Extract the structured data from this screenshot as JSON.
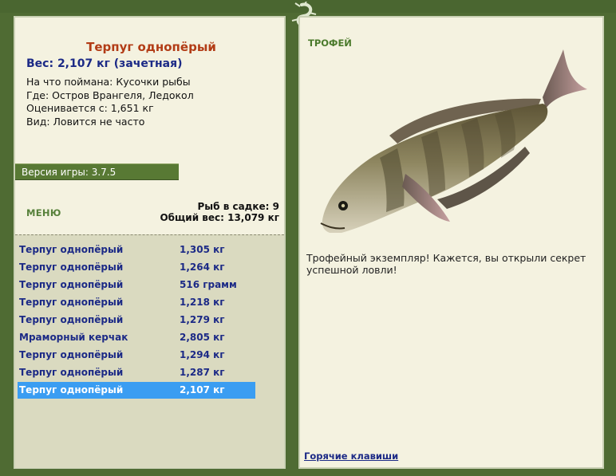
{
  "catch": {
    "name": "Терпуг однопёрый",
    "weight_line": "Вес: 2,107 кг (зачетная)",
    "bait": "На что поймана: Кусочки рыбы",
    "location": "Где: Остров Врангеля, Ледокол",
    "value": "Оценивается с: 1,651 кг",
    "rarity": "Вид: Ловится не часто"
  },
  "version": "Версия игры: 3.7.5",
  "menu_label": "МЕНЮ",
  "stats": {
    "count": "Рыб в садке: 9",
    "total": "Общий вес: 13,079 кг"
  },
  "keepnet": [
    {
      "name": "Терпуг однопёрый",
      "weight": "1,305 кг"
    },
    {
      "name": "Терпуг однопёрый",
      "weight": "1,264 кг"
    },
    {
      "name": "Терпуг однопёрый",
      "weight": "516 грамм"
    },
    {
      "name": "Терпуг однопёрый",
      "weight": "1,218 кг"
    },
    {
      "name": "Терпуг однопёрый",
      "weight": "1,279 кг"
    },
    {
      "name": "Мраморный керчак",
      "weight": "2,805 кг"
    },
    {
      "name": "Терпуг однопёрый",
      "weight": "1,294 кг"
    },
    {
      "name": "Терпуг однопёрый",
      "weight": "1,287 кг"
    },
    {
      "name": "Терпуг однопёрый",
      "weight": "2,107 кг"
    }
  ],
  "selected_index": 8,
  "trophy": {
    "label": "ТРОФЕЙ",
    "text": "Трофейный экземпляр! Кажется, вы открыли секрет успешной ловли!"
  },
  "hotkeys": "Горячие клавиши",
  "colors": {
    "background": "#4f6b33",
    "panel": "#f4f2e0",
    "title_red": "#b23c16",
    "text_blue": "#1c2a86",
    "selection": "#3a9df2"
  }
}
